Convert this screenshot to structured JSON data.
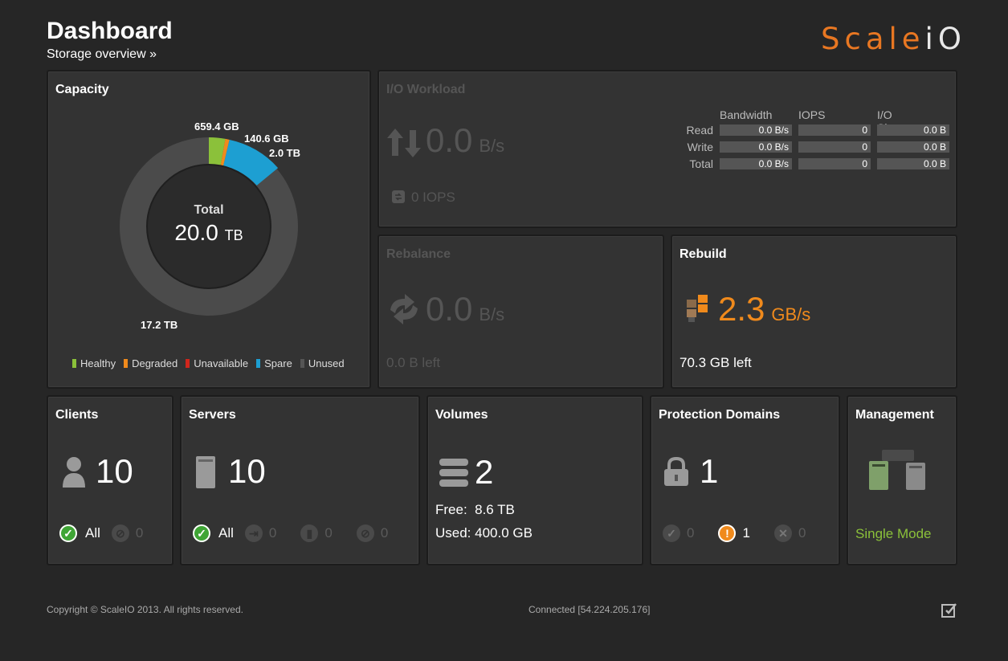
{
  "header": {
    "title": "Dashboard",
    "subtitle": "Storage overview »",
    "logo_part1": "Scale",
    "logo_part2": "iO"
  },
  "capacity": {
    "title": "Capacity",
    "total_label": "Total",
    "total_value": "20.0",
    "total_unit": "TB",
    "labels": {
      "healthy": "659.4 GB",
      "degraded": "140.6 GB",
      "spare": "2.0 TB",
      "unused": "17.2 TB"
    },
    "legend": [
      {
        "label": "Healthy",
        "color": "#8bc13a"
      },
      {
        "label": "Degraded",
        "color": "#f08a1c"
      },
      {
        "label": "Unavailable",
        "color": "#d0261c"
      },
      {
        "label": "Spare",
        "color": "#1d9fd2"
      },
      {
        "label": "Unused",
        "color": "#555555"
      }
    ]
  },
  "io_workload": {
    "title": "I/O Workload",
    "value": "0.0",
    "unit": "B/s",
    "iops": "0 IOPS",
    "columns": [
      "Bandwidth",
      "IOPS",
      "I/O Size"
    ],
    "rows": [
      {
        "label": "Read",
        "bandwidth": "0.0 B/s",
        "iops": "0",
        "size": "0.0 B"
      },
      {
        "label": "Write",
        "bandwidth": "0.0 B/s",
        "iops": "0",
        "size": "0.0 B"
      },
      {
        "label": "Total",
        "bandwidth": "0.0 B/s",
        "iops": "0",
        "size": "0.0 B"
      }
    ]
  },
  "rebalance": {
    "title": "Rebalance",
    "value": "0.0",
    "unit": "B/s",
    "left": "0.0 B left"
  },
  "rebuild": {
    "title": "Rebuild",
    "value": "2.3",
    "unit": "GB/s",
    "left": "70.3 GB left"
  },
  "clients": {
    "title": "Clients",
    "count": "10",
    "all_label": "All",
    "disconnected": "0"
  },
  "servers": {
    "title": "Servers",
    "count": "10",
    "all_label": "All",
    "stat2": "0",
    "stat3": "0",
    "stat4": "0"
  },
  "volumes": {
    "title": "Volumes",
    "count": "2",
    "free": "Free:  8.6 TB",
    "used": "Used: 400.0 GB"
  },
  "protection_domains": {
    "title": "Protection Domains",
    "count": "1",
    "ok": "0",
    "warning": "1",
    "error": "0"
  },
  "management": {
    "title": "Management",
    "mode": "Single Mode"
  },
  "footer": {
    "copyright": "Copyright © ScaleIO 2013. All rights reserved.",
    "connected": "Connected [54.224.205.176]"
  }
}
